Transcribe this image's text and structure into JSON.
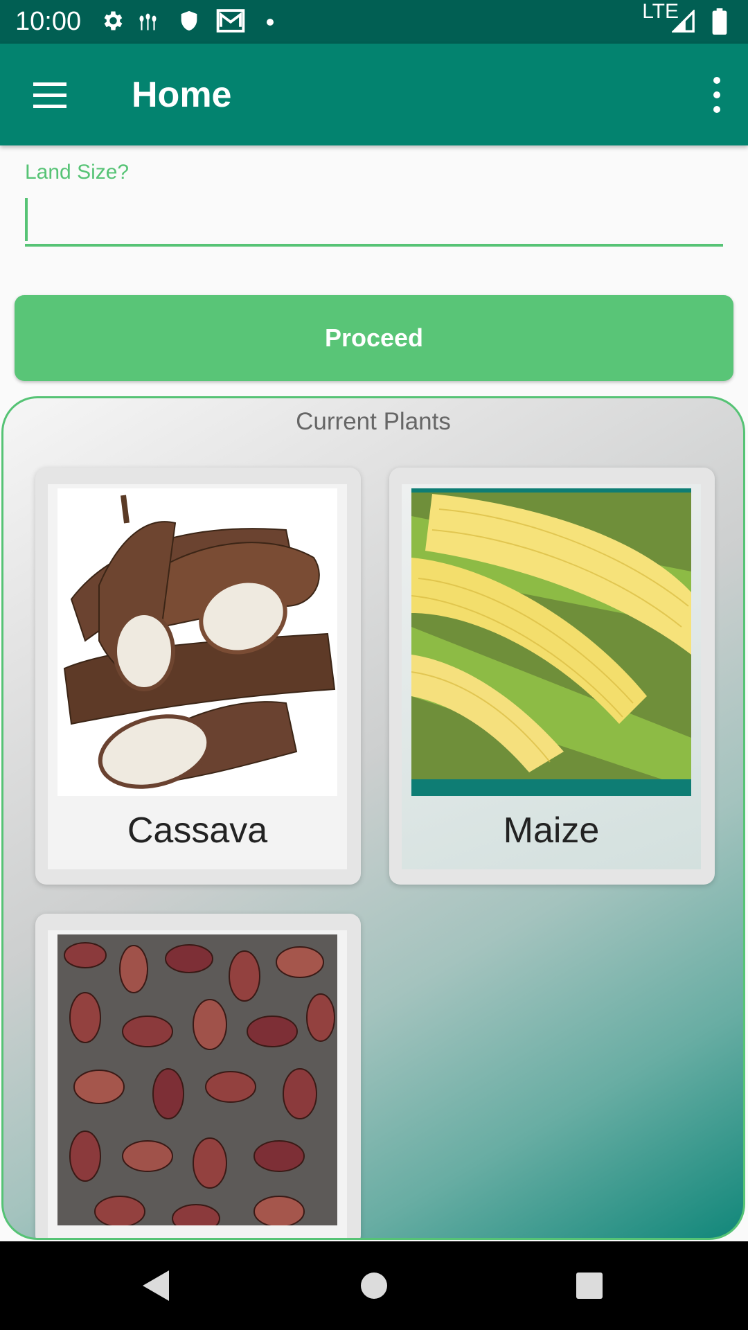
{
  "status": {
    "time": "10:00",
    "network": "LTE",
    "icons": [
      "settings-icon",
      "wheat-icon",
      "shield-icon",
      "gmail-icon",
      "dot-icon",
      "signal-icon",
      "battery-icon"
    ]
  },
  "app_bar": {
    "title": "Home",
    "icons": [
      "menu-icon",
      "overflow-menu-icon"
    ],
    "background": "#03836f"
  },
  "land_size": {
    "label": "Land Size?",
    "value": "",
    "accent": "#56c375"
  },
  "proceed": {
    "label": "Proceed",
    "color": "#59c577"
  },
  "plants": {
    "title": "Current Plants",
    "items": [
      {
        "name": "Cassava",
        "image": "cassava-image"
      },
      {
        "name": "Maize",
        "image": "maize-image"
      },
      {
        "name": "",
        "image": "beans-image"
      }
    ]
  },
  "nav": {
    "icons": [
      "back-icon",
      "home-icon",
      "recents-icon"
    ]
  }
}
